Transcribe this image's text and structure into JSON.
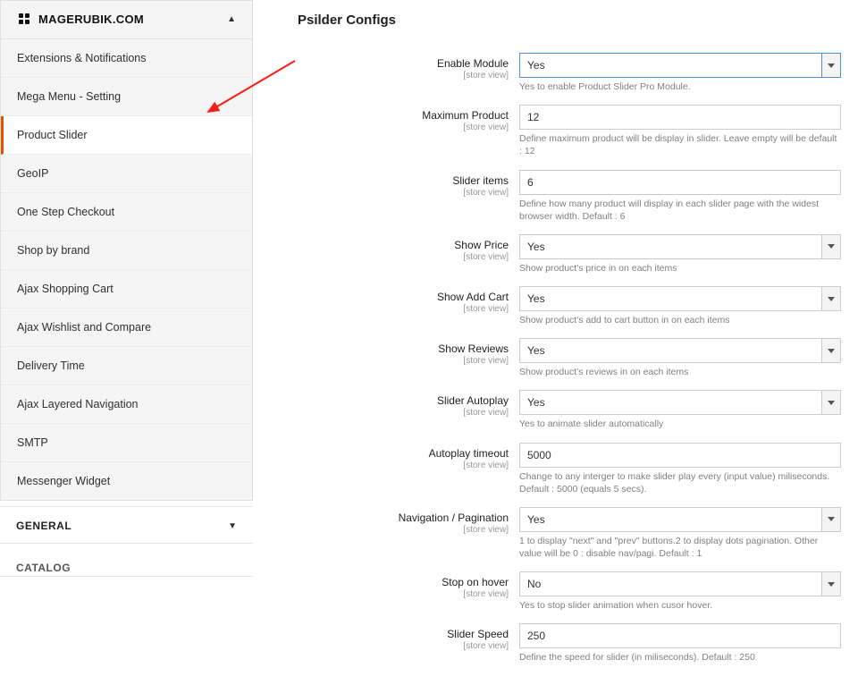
{
  "brand": {
    "name": "MAGERUBIK.COM"
  },
  "sidebar": {
    "items": [
      {
        "label": "Extensions & Notifications"
      },
      {
        "label": "Mega Menu - Setting"
      },
      {
        "label": "Product Slider"
      },
      {
        "label": "GeoIP"
      },
      {
        "label": "One Step Checkout"
      },
      {
        "label": "Shop by brand"
      },
      {
        "label": "Ajax Shopping Cart"
      },
      {
        "label": "Ajax Wishlist and Compare"
      },
      {
        "label": "Delivery Time"
      },
      {
        "label": "Ajax Layered Navigation"
      },
      {
        "label": "SMTP"
      },
      {
        "label": "Messenger Widget"
      }
    ],
    "sections": [
      {
        "label": "GENERAL"
      },
      {
        "label": "CATALOG"
      }
    ]
  },
  "page": {
    "title": "Psilder Configs"
  },
  "scope_label": "[store view]",
  "fields": {
    "enable_module": {
      "label": "Enable Module",
      "value": "Yes",
      "hint": "Yes to enable Product Slider Pro Module."
    },
    "maximum_product": {
      "label": "Maximum Product",
      "value": "12",
      "hint": "Define maximum product will be display in slider. Leave empty will be default : 12"
    },
    "slider_items": {
      "label": "Slider items",
      "value": "6",
      "hint": "Define how many product will display in each slider page with the widest browser width. Default : 6"
    },
    "show_price": {
      "label": "Show Price",
      "value": "Yes",
      "hint": "Show product's price in on each items"
    },
    "show_add_cart": {
      "label": "Show Add Cart",
      "value": "Yes",
      "hint": "Show product's add to cart button in on each items"
    },
    "show_reviews": {
      "label": "Show Reviews",
      "value": "Yes",
      "hint": "Show product's reviews in on each items"
    },
    "slider_autoplay": {
      "label": "Slider Autoplay",
      "value": "Yes",
      "hint": "Yes to animate slider automatically"
    },
    "autoplay_timeout": {
      "label": "Autoplay timeout",
      "value": "5000",
      "hint": "Change to any interger to make slider play every (input value) miliseconds. Default : 5000 (equals 5 secs)."
    },
    "nav_pagination": {
      "label": "Navigation / Pagination",
      "value": "Yes",
      "hint": "1 to display \"next\" and \"prev\" buttons.2 to display dots pagination. Other value will be 0 : disable nav/pagi. Default : 1"
    },
    "stop_on_hover": {
      "label": "Stop on hover",
      "value": "No",
      "hint": "Yes to stop slider animation when cusor hover."
    },
    "slider_speed": {
      "label": "Slider Speed",
      "value": "250",
      "hint": "Define the speed for slider (in miliseconds). Default : 250"
    }
  }
}
